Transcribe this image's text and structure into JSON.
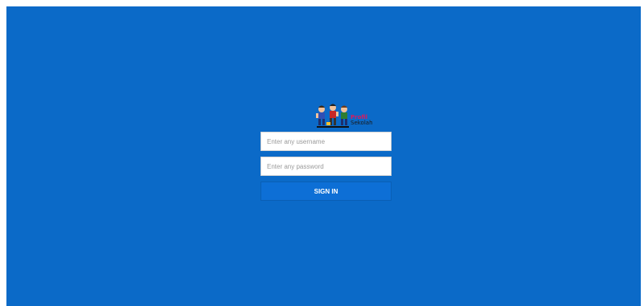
{
  "logo": {
    "line1": "Profil",
    "line2": "Sekolah",
    "icon": "school-kids-logo"
  },
  "form": {
    "username_placeholder": "Enter any username",
    "username_value": "",
    "password_placeholder": "Enter any password",
    "password_value": "",
    "signin_label": "SIGN IN"
  },
  "colors": {
    "background": "#0b6ac8",
    "button": "#0d6fd6",
    "input_bg": "#ffffff"
  }
}
